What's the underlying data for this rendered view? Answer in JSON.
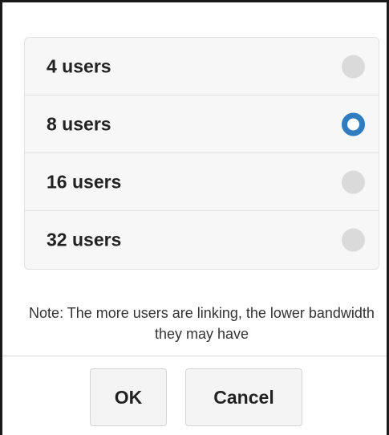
{
  "options": [
    {
      "label": "4 users",
      "selected": false
    },
    {
      "label": "8 users",
      "selected": true
    },
    {
      "label": "16 users",
      "selected": false
    },
    {
      "label": "32 users",
      "selected": false
    }
  ],
  "note": "Note: The more users are linking, the lower bandwidth they may have",
  "buttons": {
    "ok_label": "OK",
    "cancel_label": "Cancel"
  },
  "colors": {
    "accent": "#2f7cc0",
    "radio_unselected": "#dadada"
  }
}
